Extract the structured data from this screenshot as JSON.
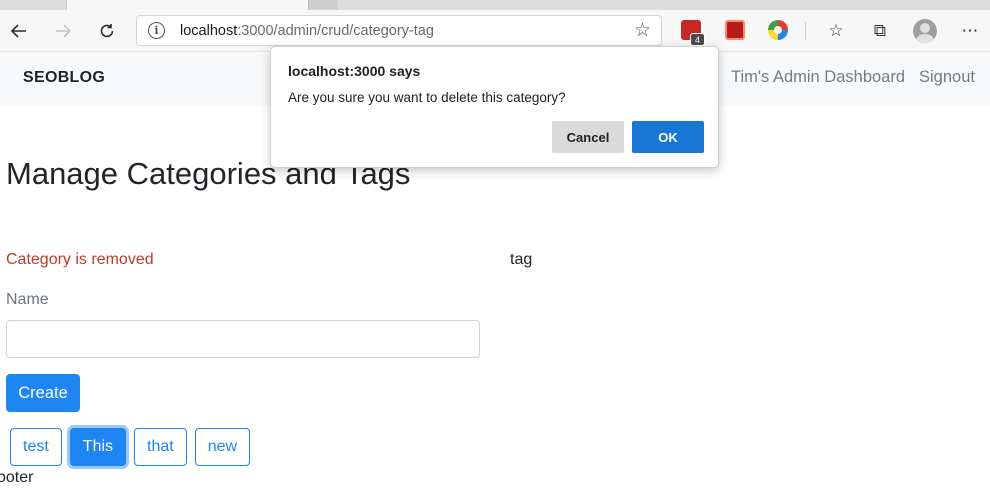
{
  "browser": {
    "url_host": "localhost",
    "url_path": ":3000/admin/crud/category-tag",
    "extension_badge": "4"
  },
  "nav": {
    "brand": "SEOBLOG",
    "dashboard_link": "Tim's Admin Dashboard",
    "signout_link": "Signout"
  },
  "page": {
    "title": "Manage Categories and Tags",
    "status_message": "Category is removed",
    "tag_heading": "tag",
    "name_label": "Name",
    "name_value": "",
    "create_label": "Create",
    "tags": [
      "test",
      "This",
      "that",
      "new"
    ],
    "active_tag": "This",
    "footer": "ooter"
  },
  "dialog": {
    "title": "localhost:3000 says",
    "message": "Are you sure you want to delete this category?",
    "cancel_label": "Cancel",
    "ok_label": "OK"
  },
  "colors": {
    "primary": "#1e85f3",
    "error_text": "#c0392b",
    "dialog_ok": "#1976d2"
  }
}
